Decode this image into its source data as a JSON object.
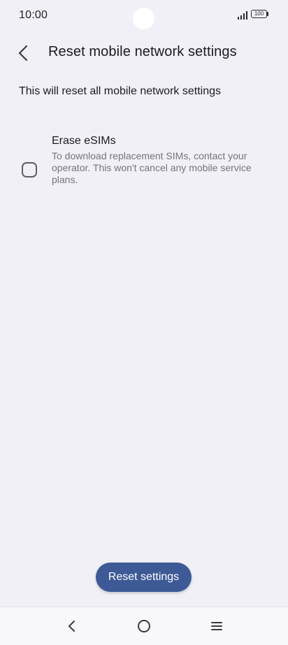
{
  "status_bar": {
    "time": "10:00",
    "battery_level": "100",
    "icons": [
      "signal-icon",
      "battery-icon"
    ]
  },
  "app_bar": {
    "title": "Reset mobile network settings",
    "back_icon": "back-arrow-icon"
  },
  "content": {
    "description": "This will reset all mobile network settings",
    "erase_esims": {
      "title": "Erase eSIMs",
      "summary": "To download replacement SIMs, contact your operator. This won't cancel any mobile service plans.",
      "checked": false
    }
  },
  "actions": {
    "reset_label": "Reset settings"
  },
  "nav_bar": {
    "icons": [
      "nav-back-icon",
      "nav-home-icon",
      "nav-recents-icon"
    ]
  },
  "colors": {
    "background": "#f1f0f7",
    "primary_button": "#3d5a96",
    "text_primary": "#1b1b1f",
    "text_secondary": "#74747c"
  }
}
